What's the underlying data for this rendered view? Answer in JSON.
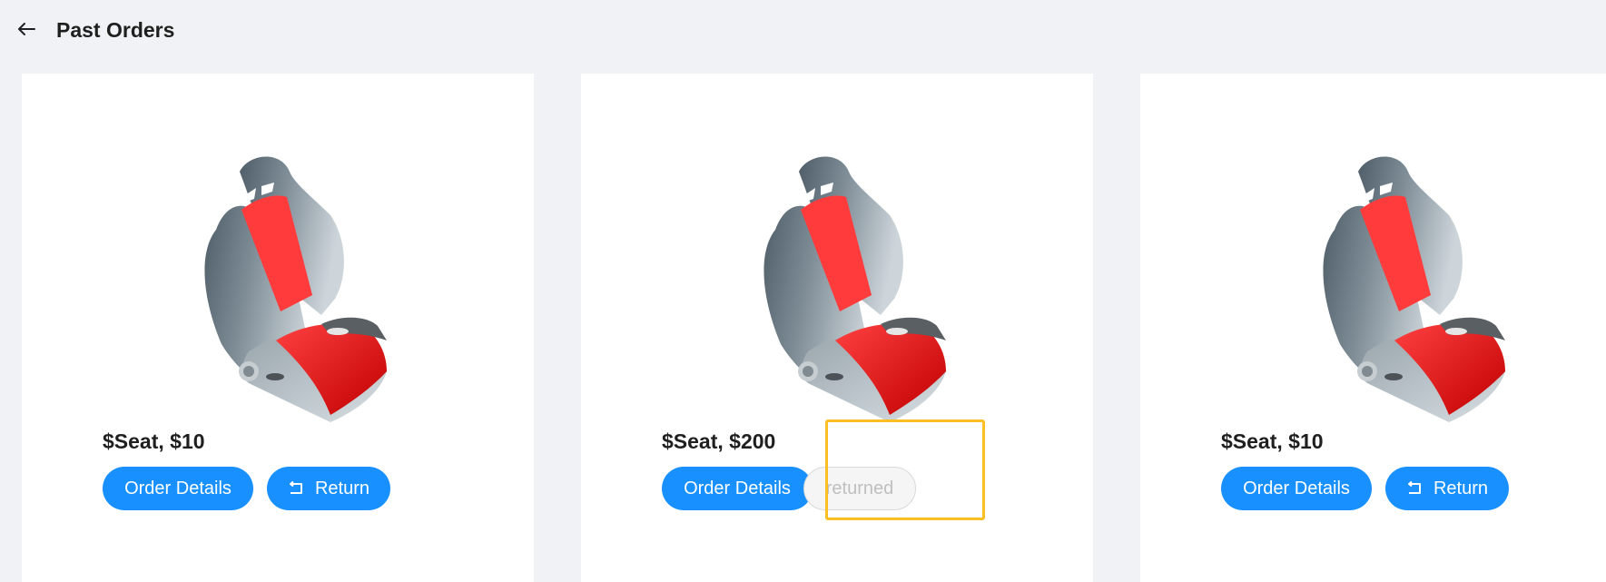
{
  "header": {
    "back_icon": "arrow-left-icon",
    "title": "Past Orders"
  },
  "orders": [
    {
      "price_text": "$Seat, $10",
      "details_label": "Order Details",
      "action_label": "Return",
      "action_icon": "return-icon",
      "status": "returnable"
    },
    {
      "price_text": "$Seat, $200",
      "details_label": "Order Details",
      "action_label": "returned",
      "status": "returned"
    },
    {
      "price_text": "$Seat, $10",
      "details_label": "Order Details",
      "action_label": "Return",
      "action_icon": "return-icon",
      "status": "returnable"
    }
  ],
  "colors": {
    "background": "#f0f2f5",
    "card": "#ffffff",
    "primary": "#1890ff",
    "disabled_bg": "#f5f5f5",
    "disabled_text": "#bfbfbf",
    "highlight": "#fbbf24",
    "seat_red": "#ff3b3b"
  }
}
